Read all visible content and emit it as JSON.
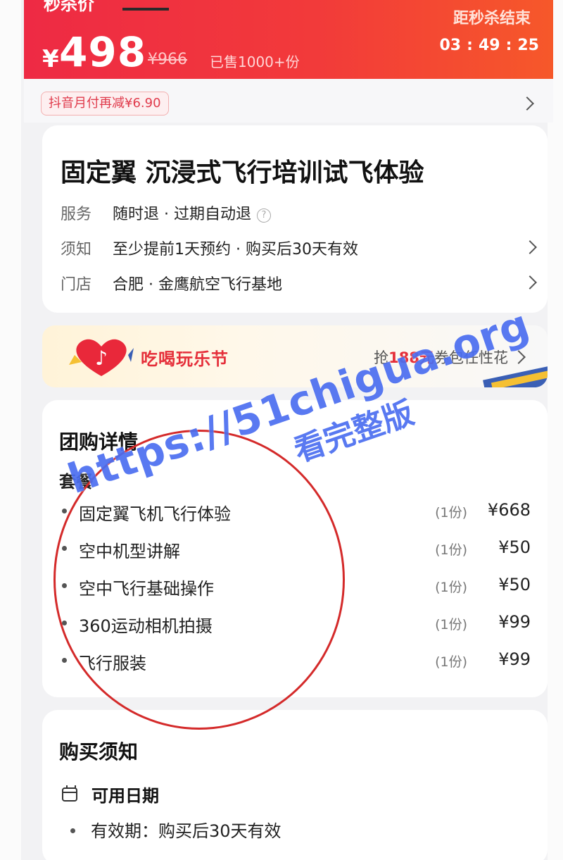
{
  "flash_sale": {
    "label_cut": "秒杀价",
    "currency": "¥",
    "price": "498",
    "original_price": "¥966",
    "sold": "已售1000+份",
    "ends_label": "距秒杀结束",
    "timer": {
      "hours": "03",
      "minutes": "49",
      "seconds": "25",
      "separator": ":"
    }
  },
  "coupon": {
    "text": "抖音月付再减¥6.90"
  },
  "product": {
    "title": "固定翼 沉浸式飞行培训试飞体验",
    "rows": [
      {
        "key": "服务",
        "value": "随时退 · 过期自动退"
      },
      {
        "key": "须知",
        "value": "至少提前1天预约 · 购买后30天有效"
      },
      {
        "key": "门店",
        "value": "合肥 · 金鹰航空飞行基地"
      }
    ],
    "help_icon_glyph": "?"
  },
  "promo": {
    "logo_glyph": "♪",
    "title": "吃喝玩乐节",
    "right_prefix": "抢",
    "right_amount": "188元",
    "right_suffix": "券包任性花"
  },
  "details": {
    "title": "团购详情",
    "package_label": "套餐",
    "items": [
      {
        "name": "固定翼飞机飞行体验",
        "count": "(1份)",
        "price": "¥668"
      },
      {
        "name": "空中机型讲解",
        "count": "(1份)",
        "price": "¥50"
      },
      {
        "name": "空中飞行基础操作",
        "count": "(1份)",
        "price": "¥50"
      },
      {
        "name": "360运动相机拍摄",
        "count": "(1份)",
        "price": "¥99"
      },
      {
        "name": "飞行服装",
        "count": "(1份)",
        "price": "¥99"
      }
    ]
  },
  "notice": {
    "title": "购买须知",
    "date_label": "可用日期",
    "validity": "有效期：购买后30天有效"
  },
  "watermark": {
    "url": "https://51chigua.org",
    "sub": "看完整版"
  },
  "colors": {
    "accent": "#ee2a44",
    "promo_red": "#e52f3a",
    "watermark": "#4b6ef0",
    "circle": "#d42a2a"
  }
}
